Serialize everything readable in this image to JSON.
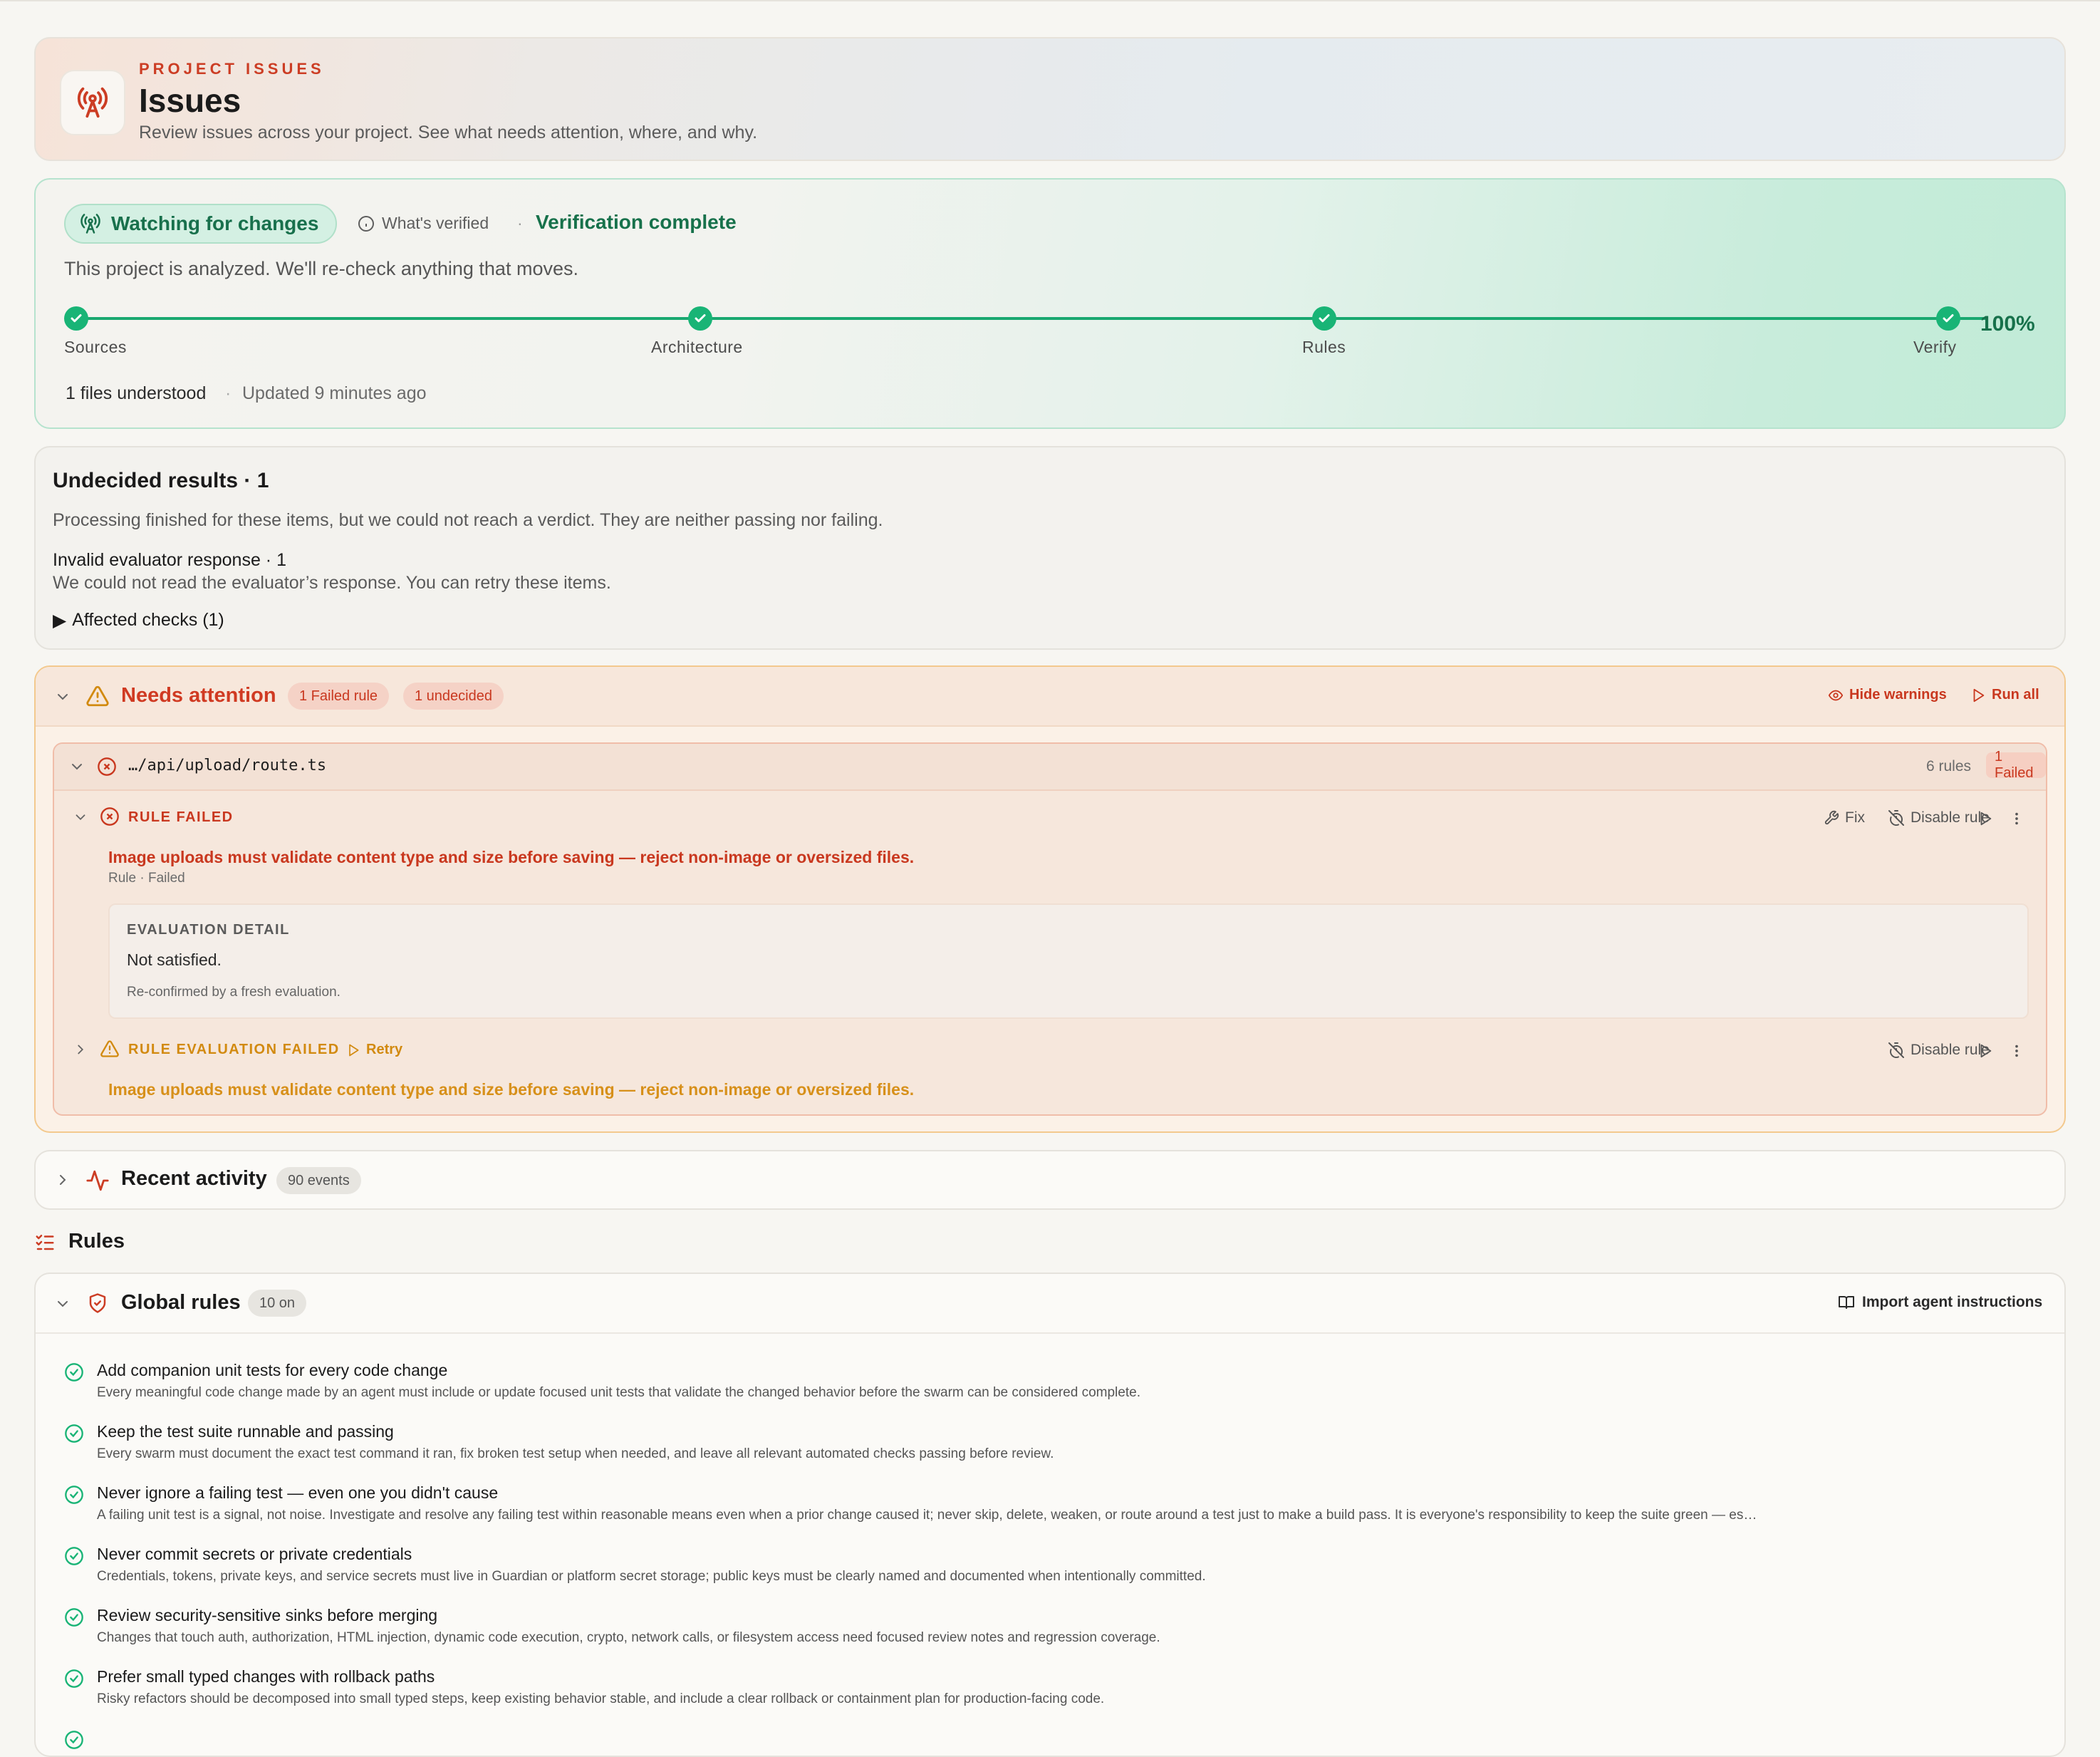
{
  "header": {
    "eyebrow": "PROJECT ISSUES",
    "title": "Issues",
    "subtitle": "Review issues across your project. See what needs attention, where, and why."
  },
  "status": {
    "pill": "Watching for changes",
    "verified_link": "What's verified",
    "complete": "Verification complete",
    "description": "This project is analyzed. We'll re-check anything that moves.",
    "steps": [
      "Sources",
      "Architecture",
      "Rules",
      "Verify"
    ],
    "progress": "100%",
    "files": "1 files understood",
    "updated": "Updated 9 minutes ago"
  },
  "undecided": {
    "title": "Undecided results · 1",
    "description": "Processing finished for these items, but we could not reach a verdict. They are neither passing nor failing.",
    "group_title": "Invalid evaluator response · 1",
    "group_desc": "We could not read the evaluator’s response. You can retry these items.",
    "affected": "Affected checks (1)"
  },
  "attention": {
    "title": "Needs attention",
    "badge_failed": "1 Failed rule",
    "badge_undecided": "1 undecided",
    "hide_warnings": "Hide warnings",
    "run_all": "Run all",
    "file": {
      "path": "…/api/upload/route.ts",
      "rules_count": "6 rules",
      "failed_badge": "1 Failed",
      "rule_failed_label": "RULE FAILED",
      "fix": "Fix",
      "disable": "Disable rule",
      "rule_text": "Image uploads must validate content type and size before saving — reject non-image or oversized files.",
      "rule_meta": "Rule · Failed",
      "eval_title": "EVALUATION DETAIL",
      "eval_value": "Not satisfied.",
      "eval_note": "Re-confirmed by a fresh evaluation.",
      "eval_failed_label": "RULE EVALUATION FAILED",
      "retry": "Retry",
      "disable2": "Disable rule",
      "rule_text2": "Image uploads must validate content type and size before saving — reject non-image or oversized files."
    }
  },
  "activity": {
    "title": "Recent activity",
    "badge": "90 events"
  },
  "rules": {
    "heading": "Rules",
    "global_title": "Global rules",
    "global_badge": "10 on",
    "import": "Import agent instructions",
    "items": [
      {
        "title": "Add companion unit tests for every code change",
        "desc": "Every meaningful code change made by an agent must include or update focused unit tests that validate the changed behavior before the swarm can be considered complete."
      },
      {
        "title": "Keep the test suite runnable and passing",
        "desc": "Every swarm must document the exact test command it ran, fix broken test setup when needed, and leave all relevant automated checks passing before review."
      },
      {
        "title": "Never ignore a failing test — even one you didn't cause",
        "desc": "A failing unit test is a signal, not noise. Investigate and resolve any failing test within reasonable means even when a prior change caused it; never skip, delete, weaken, or route around a test just to make a build pass. It is everyone's responsibility to keep the suite green — es…"
      },
      {
        "title": "Never commit secrets or private credentials",
        "desc": "Credentials, tokens, private keys, and service secrets must live in Guardian or platform secret storage; public keys must be clearly named and documented when intentionally committed."
      },
      {
        "title": "Review security-sensitive sinks before merging",
        "desc": "Changes that touch auth, authorization, HTML injection, dynamic code execution, crypto, network calls, or filesystem access need focused review notes and regression coverage."
      },
      {
        "title": "Prefer small typed changes with rollback paths",
        "desc": "Risky refactors should be decomposed into small typed steps, keep existing behavior stable, and include a clear rollback or containment plan for production-facing code."
      }
    ]
  },
  "colors": {
    "accent_red": "#c9381f",
    "success_green": "#19b476",
    "warning_amber": "#d28a10"
  }
}
